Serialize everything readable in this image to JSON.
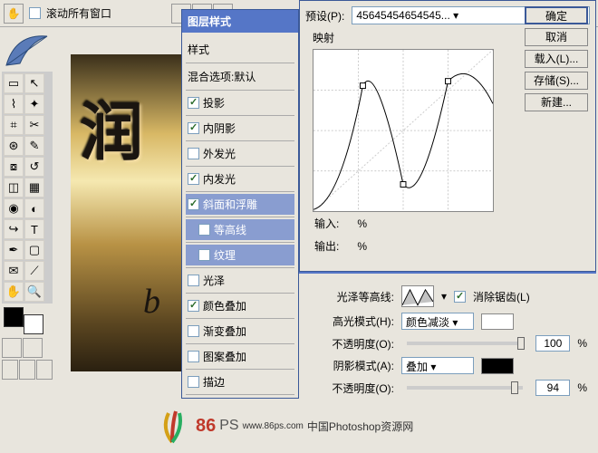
{
  "topbar": {
    "scroll_all": "滚动所有窗口"
  },
  "style_panel": {
    "title": "图层样式",
    "styles_label": "样式",
    "blend_label": "混合选项:默认",
    "items": [
      {
        "label": "投影",
        "checked": true,
        "sel": false
      },
      {
        "label": "内阴影",
        "checked": true,
        "sel": false
      },
      {
        "label": "外发光",
        "checked": false,
        "sel": false
      },
      {
        "label": "内发光",
        "checked": true,
        "sel": false
      },
      {
        "label": "斜面和浮雕",
        "checked": true,
        "sel": true
      },
      {
        "label": "等高线",
        "checked": false,
        "sel": true,
        "sub": true
      },
      {
        "label": "纹理",
        "checked": false,
        "sel": true,
        "sub": true
      },
      {
        "label": "光泽",
        "checked": false,
        "sel": false
      },
      {
        "label": "颜色叠加",
        "checked": true,
        "sel": false
      },
      {
        "label": "渐变叠加",
        "checked": false,
        "sel": false
      },
      {
        "label": "图案叠加",
        "checked": false,
        "sel": false
      },
      {
        "label": "描边",
        "checked": false,
        "sel": false
      }
    ]
  },
  "dialog": {
    "preset_label": "预设(P):",
    "preset_value": "45645454654545...",
    "ok": "确定",
    "cancel": "取消",
    "load": "载入(L)...",
    "save": "存储(S)...",
    "new": "新建...",
    "curve_title": "映射",
    "input_label": "输入:",
    "output_label": "输出:",
    "pct": "%"
  },
  "bevel": {
    "gloss_contour": "光泽等高线:",
    "antialias": "消除锯齿(L)",
    "hl_mode": "高光模式(H):",
    "hl_blend": "颜色减淡",
    "opacity": "不透明度(O):",
    "hl_op": "100",
    "sh_mode": "阴影模式(A):",
    "sh_blend": "叠加",
    "sh_op": "94",
    "pct": "%"
  },
  "canvas": {
    "char": "润",
    "b": "b"
  },
  "watermark": {
    "brand": "86",
    "ps": "PS",
    "url": "www.86ps.com",
    "tag": "中国Photoshop资源网"
  }
}
